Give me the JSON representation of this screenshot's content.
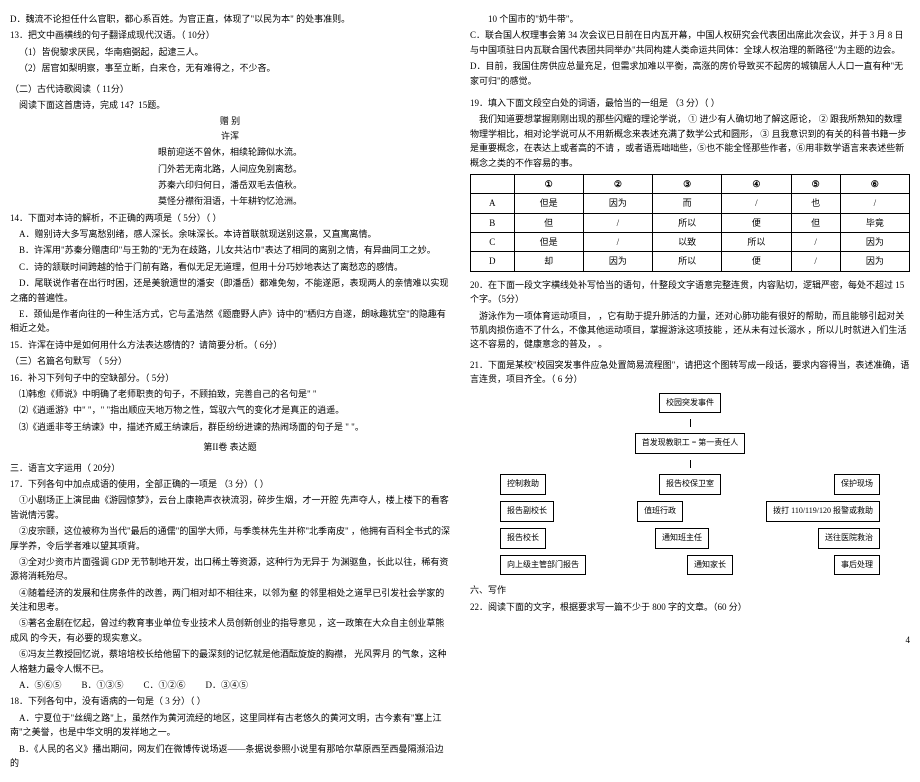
{
  "left": {
    "d12": "D．魏流不论担任什么官职，都心系百姓。为官正直，体现了\"以民为本\" 的处事准则。",
    "q13": "13．把文中画横线的句子翻译成现代汉语。（ 10分）",
    "q13_1": "（1）皆倪黎求厌民，华南痼弼起，起逮三人。",
    "q13_2": "（2）居官如梨明察，事至立断，白来仓，无有难得之，不少吝。",
    "sec2": "（二）古代诗歌阅读（ 11分）",
    "sec2b": "阅读下面这首唐诗，完成 14？15题。",
    "poem_title": "赠 别",
    "poem_author": "许浑",
    "poem_l1": "眼前迎送不曾休，相续轮蹄似水流。",
    "poem_l2": "门外若无南北路，人间应免别离愁。",
    "poem_l3": "苏秦六印归何日，潘岳双毛去值秋。",
    "poem_l4": "莫怪分襟衔泪语，十年耕钓忆沧洲。",
    "q14": "14．下面对本诗的解析，不正确的两项是（ 5分）（ ）",
    "q14a": "A．赠别诗大多写离愁别绪，感人深长。余味深长。本诗首联就现送别这景，又直寓离情。",
    "q14b": "B．许浑用\"苏秦分赠唐印\"与王勃的\"无为在歧路，儿女共沾巾\"表达了相同的离别之情，有异曲同工之妙。",
    "q14c": "C．诗的颔联时间跨越的恰于门前有路，看似无足无道理，但用十分巧妙地表达了离愁恋的感情。",
    "q14d": "D．尾联说作者在出行时困，还是美貌遗世的潘安（即潘岳）都难免匆，不能遂愿，表现两人的亲情难以实现之痛的普遍性。",
    "q14e": "E．颈仙是作者向往的一种生活方式，它与孟浩然《题鹿野人庐》诗中的\"栖归方自遂，朗咏趣犹空\"的隐趣有相近之处。",
    "q15": "15．许浑在诗中是如何用什么方法表达感情的？请简要分析。（ 6分）",
    "q15b": "（三）名篇名句默写 （ 5分）",
    "q16": "16．补习下列句子中的空缺部分。（ 5分）",
    "q16_1": "⑴韩愈《师说》中明确了老师职责的句子，不顾拍致，完善自己的名句是\" \"",
    "q16_2": "⑵《逍遥游》中\" \"，\" \"指出顺应天地万物之性，驾驭六气的变化才是真正的逍遥。",
    "q16_3": "⑶《逍遥非苓王纳谏》中，描述齐威王纳谏后，群臣纷纷进谏的热闹场面的句子是 \" \"。",
    "part2": "第II卷 表达题",
    "sec3": "三．语言文字运用（ 20分）",
    "q17": "17．下列各句中加点成语的使用，全部正确的一项是 （3 分）（ ）",
    "q17_1": "①小剧场正上演昆曲《游园惊梦》，云台上康艳声衣袂流羽，碎步生烟，才一开腔 先声夺人，楼上楼下的看客皆说情污雾。",
    "q17_2": "②皮宗颐，这位被称为当代\"最后的通儒\"的国学大师，与季羡林先生并称\"北季南皮\" ，他拥有百科全书式的深厚学养，令后学者难以望其项背。",
    "q17_3": "③全对少资市片面强调 GDP 无节制地开发，出口稀土等资源，这种行为无异于 为渊驱鱼，长此以往，稀有资源将消耗殆尽。",
    "q17_4": "④随着经济的发展和住房条件的改善，两门相对却不相往来，以邻为壑 的邻里相处之道早已引发社会学家的关注和思考。",
    "q17_5": "⑤著名金剧在忆起，曾过约教育事业单位专业技术人员创新创业的指导意见 ，这一政策在大众自主创业草熊成风 的今天，有必要的现实意义。",
    "q17_6": "⑥冯友兰教授回忆说，蔡培培校长给他留下的最深刻的记忆就是他酒酝旋旋的胸襟， 光风霁月 的气象，这种人格魅力最令人慨不已。",
    "q17opts": {
      "a": "A．⑤⑥⑤",
      "b": "B．①③⑤",
      "c": "C．①②⑥",
      "d": "D．③④⑤"
    },
    "q18": "18．下列各句中，没有语病的一句是（ 3 分）（ ）",
    "q18a": "A．宁夏位于\"丝绸之路\"上，虽然作为黄河流经的地区，这里同样有古老悠久的黄河文明，古今素有\"塞上江南\"之美誉，也是中华文明的发祥地之一。",
    "q18b": "B．《人民的名义》播出期间，网友们在微博传说场返——条据说参照小说里有那哈尔草原西至西曼隔濒沿边的"
  },
  "right": {
    "r1": "10 个国市的\"奶牛带\"。",
    "r1c": "C．联合国人权理事会第 34 次会议已日前在日内瓦开幕，中国人权研究会代表团出席此次会议，并于 3 月 8 日与中国项驻日内瓦联合国代表团共同举办\"共同构建人类命运共同体：全球人权治理的新路径\"为主题的边会。",
    "r1d": "D．目前，我国住房供应总量充足，但需求加难以平衡，高涨的房价导致买不起房的城镇居人人口一直有种\"无家可归\"的感觉。",
    "q19": "19．填入下面文段空白处的词语，最恰当的一组是 （3 分）（ ）",
    "q19p": "我们知道要想掌握刚刚出现的那些闪耀的理论学说， ① 进少有人确切地了解这愿论， ② 跟我所熟知的数理物理学相比，相对论学说可从不用新概念来表述充满了数学公式和圆形， ③ 且我意识到的有关的科普书籍一步是重要概念，在表达上或者高的不请 ，或者语焉咄咄些，⑤也不能全怪那些作者，⑥用非数学语言来表述些新概念之类的不作容易的事。",
    "table": {
      "headers": [
        "",
        "①",
        "②",
        "③",
        "④",
        "⑤",
        "⑥"
      ],
      "rows": [
        [
          "A",
          "但是",
          "因为",
          "而",
          "/",
          "也",
          "/"
        ],
        [
          "B",
          "但",
          "/",
          "所以",
          "便",
          "但",
          "毕竟"
        ],
        [
          "C",
          "但是",
          "/",
          "以致",
          "所以",
          "/",
          "因为"
        ],
        [
          "D",
          "却",
          "因为",
          "所以",
          "便",
          "/",
          "因为"
        ]
      ]
    },
    "q20": "20．在下面一段文字横线处补写恰当的语句，什整段文字语意完整连贯，内容贴切，逻辑严密，每处不超过 15 个字。（5分）",
    "q20p": "游泳作为一项体育运动项目， ，它有助于提升肺活的力量，还对心肺功能有很好的帮助，而且能够引起对关节肌肉损伤造不了什么，不像其他运动项目，掌握游泳这项技能 ，还从未有过长溺水 ，所以儿时就进入们生活这不容易的，健康意念的普及， 。",
    "q21": "21．下面是某校\"校园突发事件应急处置简易流程图\"，请把这个图转写成一段话，要求内容得当，表述准确，语言连贯，项目齐全。（ 6 分）",
    "flow": {
      "n1": "校园突发事件",
      "n2a": "首发现教职工 = 第一责任人",
      "n3a": "控制救助",
      "n3b": "报告校保卫室",
      "n3c": "保护现场",
      "n4a": "报告副校长",
      "n4b": "值班行政",
      "n4c": "拨打 110/119/120 报警或救助",
      "n5a": "报告校长",
      "n5b": "通知班主任",
      "n5c": "送往医院救治",
      "n6a": "向上级主管部门报告",
      "n6b": "通知家长",
      "n6c": "事后处理"
    },
    "sec6": "六、写作",
    "q22": "22．阅读下面的文字，根据要求写一篇不少于 800 字的文章。（60 分）"
  },
  "pagenum": "4"
}
